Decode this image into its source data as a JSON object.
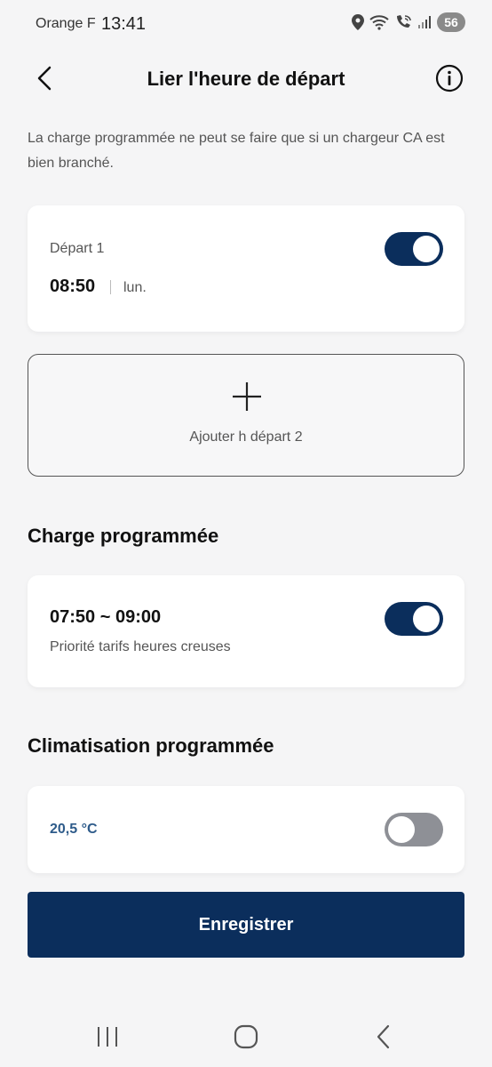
{
  "status_bar": {
    "carrier": "Orange F",
    "time": "13:41",
    "battery": "56"
  },
  "header": {
    "title": "Lier l'heure de départ",
    "back_icon": "chevron-left-icon",
    "info_icon": "info-icon"
  },
  "notice": "La charge programmée ne peut se faire que si un chargeur CA est bien branché.",
  "departure": {
    "label": "Départ 1",
    "time": "08:50",
    "day": "lun.",
    "enabled": true
  },
  "add_departure": {
    "label": "Ajouter h départ 2"
  },
  "charge": {
    "section_title": "Charge programmée",
    "time_range": "07:50 ~ 09:00",
    "description": "Priorité tarifs heures creuses",
    "enabled": true
  },
  "climate": {
    "section_title": "Climatisation programmée",
    "temperature": "20,5 °C",
    "enabled": false
  },
  "save_button": {
    "label": "Enregistrer"
  },
  "colors": {
    "primary": "#0b2e5c",
    "toggle_off": "#8e9096",
    "temperature_text": "#2e5b8a"
  }
}
